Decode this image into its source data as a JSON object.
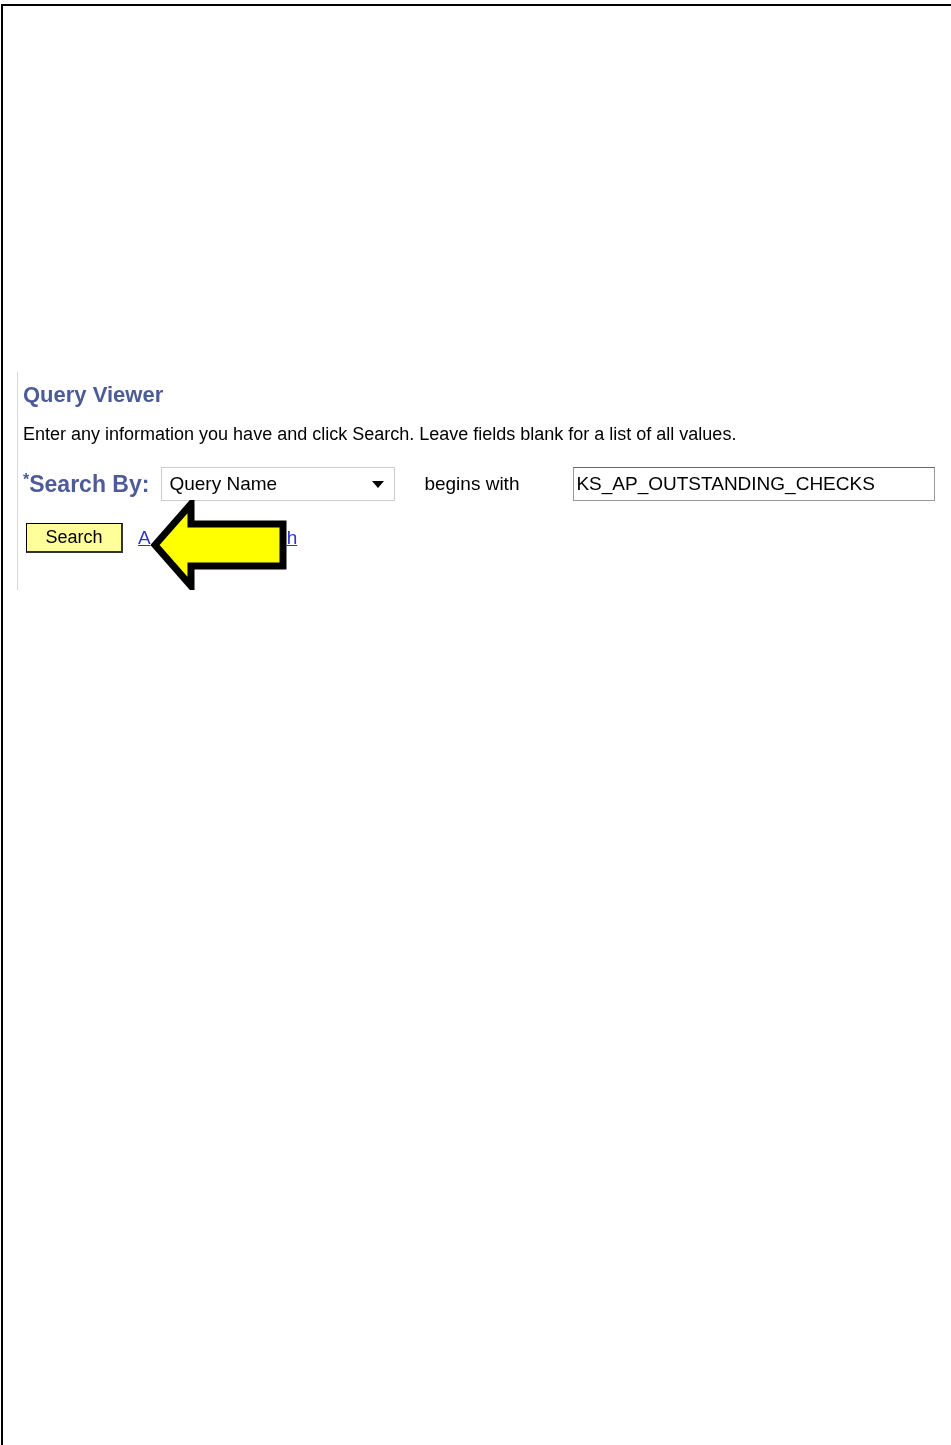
{
  "title": "Query Viewer",
  "instructions": "Enter any information you have and click Search. Leave fields blank for a list of all values.",
  "search_by": {
    "required_mark": "*",
    "label": "Search By:",
    "select_value": "Query Name",
    "operator": "begins with",
    "value": "KS_AP_OUTSTANDING_CHECKS"
  },
  "search_button": "Search",
  "link": {
    "visible_start": "A",
    "visible_end": "h"
  }
}
